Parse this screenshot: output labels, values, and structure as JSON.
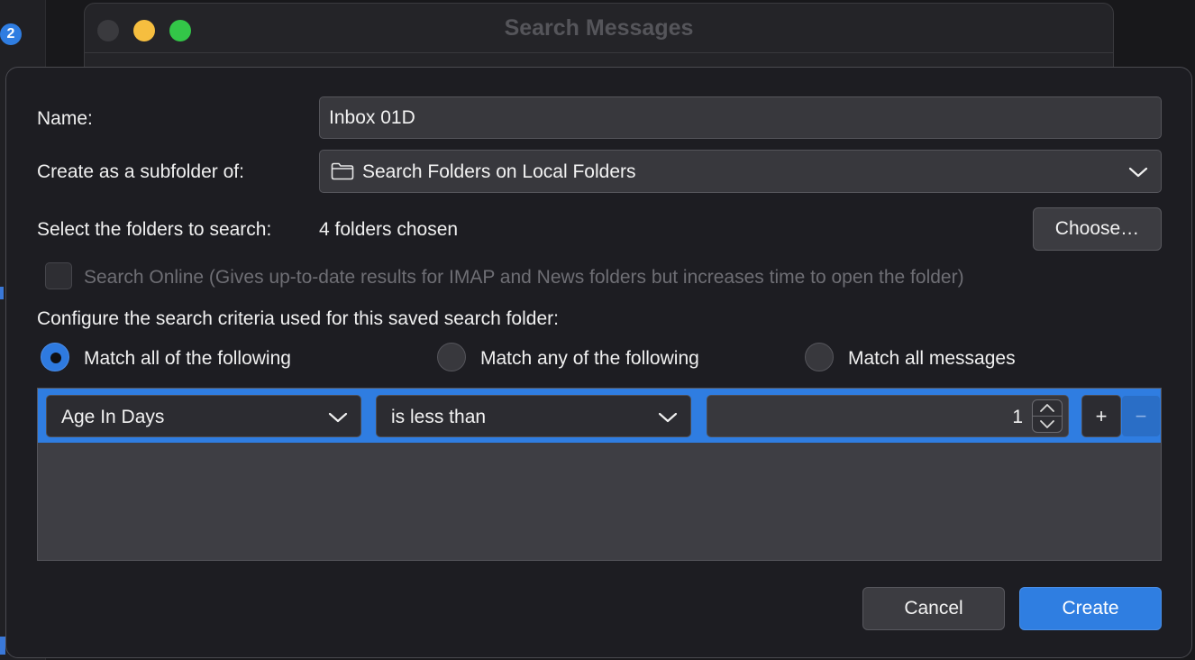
{
  "background": {
    "badge_count": "2"
  },
  "back_window": {
    "title": "Search Messages"
  },
  "dialog": {
    "name_label": "Name:",
    "name_value": "Inbox 01D",
    "subfolder_label": "Create as a subfolder of:",
    "subfolder_value": "Search Folders on Local Folders",
    "folders_label": "Select the folders to search:",
    "folders_value": "4 folders chosen",
    "choose_button": "Choose…",
    "search_online_label": "Search Online (Gives up-to-date results for IMAP and News folders but increases time to open the folder)",
    "criteria_heading": "Configure the search criteria used for this saved search folder:",
    "match_options": [
      {
        "label": "Match all of the following",
        "selected": true
      },
      {
        "label": "Match any of the following",
        "selected": false
      },
      {
        "label": "Match all messages",
        "selected": false
      }
    ],
    "rule": {
      "field": "Age In Days",
      "operator": "is less than",
      "value": "1",
      "add_label": "+",
      "remove_label": "−"
    },
    "cancel_button": "Cancel",
    "create_button": "Create"
  },
  "colors": {
    "accent": "#2f7de1",
    "dialog_bg": "#1d1d22",
    "field_bg": "#38383d"
  }
}
